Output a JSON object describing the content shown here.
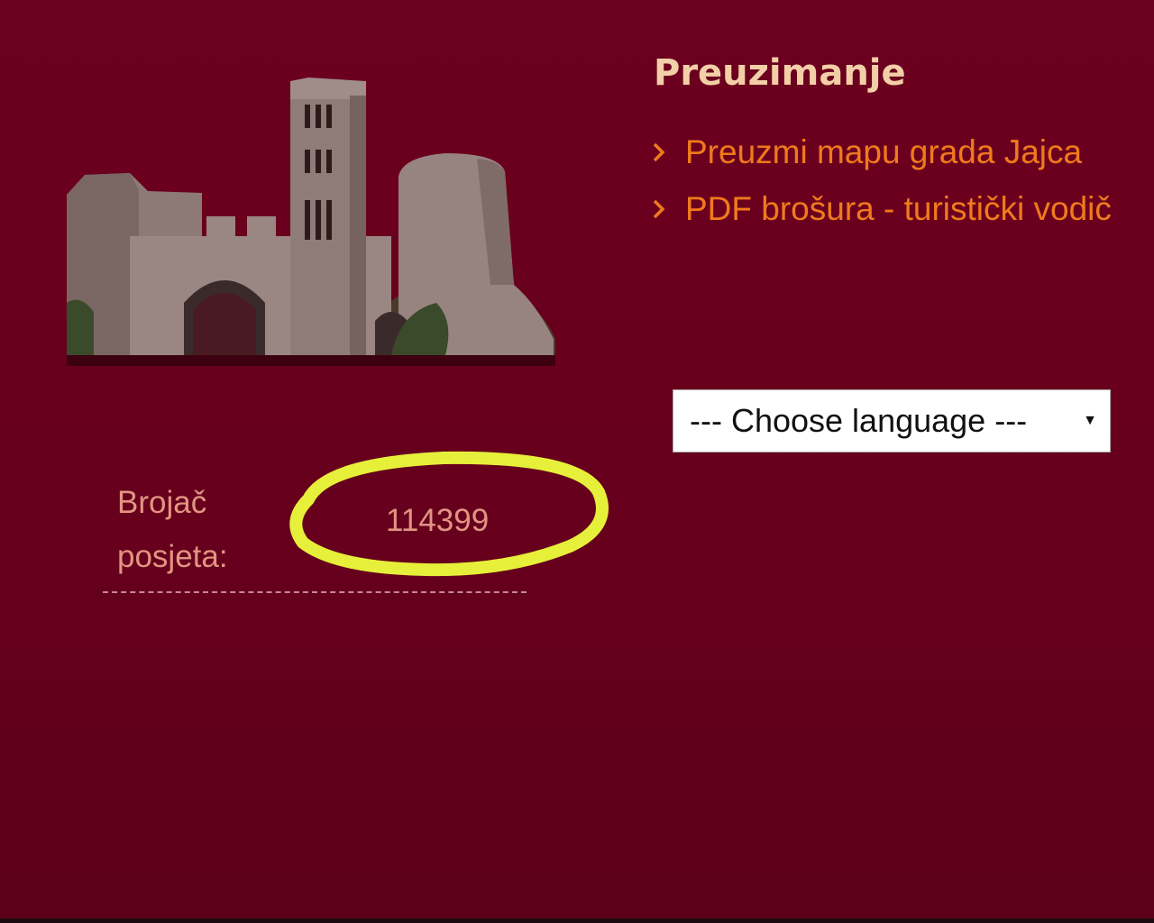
{
  "downloads": {
    "title": "Preuzimanje",
    "links": [
      {
        "label": "Preuzmi mapu grada Jajca"
      },
      {
        "label": "PDF brošura - turistički vodič"
      }
    ]
  },
  "language_select": {
    "selected": "--- Choose language ---",
    "arrow": "▼"
  },
  "counter": {
    "label": "Brojač posjeta:",
    "value": "114399"
  },
  "colors": {
    "background": "#6c001f",
    "title": "#f3cfa8",
    "link": "#f07a1c",
    "counter_text": "#e29482",
    "highlight": "#e6f03a"
  },
  "icons": {
    "link_bullet": "chevron-right-icon",
    "castle_image": "castle-illustration"
  }
}
